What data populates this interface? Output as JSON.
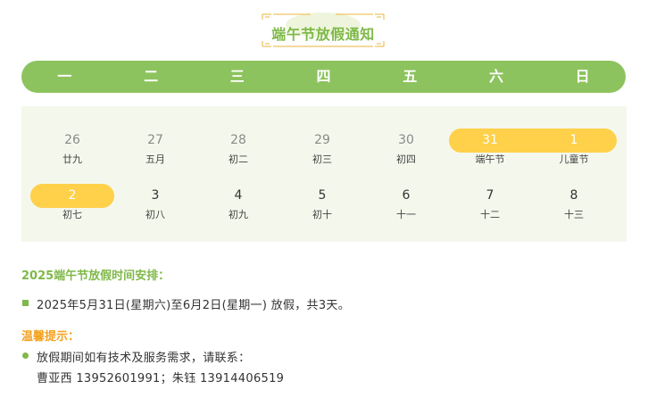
{
  "title": "端午节放假通知",
  "weekdays": [
    "一",
    "二",
    "三",
    "四",
    "五",
    "六",
    "日"
  ],
  "calendar": {
    "row1": [
      {
        "day": "26",
        "lunar": "廿九"
      },
      {
        "day": "27",
        "lunar": "五月"
      },
      {
        "day": "28",
        "lunar": "初二"
      },
      {
        "day": "29",
        "lunar": "初三"
      },
      {
        "day": "30",
        "lunar": "初四"
      },
      {
        "day": "31",
        "lunar": "端午节"
      },
      {
        "day": "1",
        "lunar": "儿童节"
      }
    ],
    "row2": [
      {
        "day": "2",
        "lunar": "初七"
      },
      {
        "day": "3",
        "lunar": "初八"
      },
      {
        "day": "4",
        "lunar": "初九"
      },
      {
        "day": "5",
        "lunar": "初十"
      },
      {
        "day": "6",
        "lunar": "十一"
      },
      {
        "day": "7",
        "lunar": "十二"
      },
      {
        "day": "8",
        "lunar": "十三"
      }
    ]
  },
  "schedule": {
    "heading": "2025端午节放假时间安排：",
    "text": "2025年5月31日(星期六)至6月2日(星期一) 放假，共3天。"
  },
  "tips": {
    "heading": "温馨提示：",
    "line1": "放假期间如有技术及服务需求，请联系：",
    "line2": "曹亚西 13952601991；朱钰 13914406519"
  },
  "colors": {
    "green": "#8dc35e",
    "title_green": "#7fb949",
    "highlight_yellow": "#ffd04a",
    "tip_orange": "#f2a21f",
    "calendar_bg": "#f4f8ec"
  }
}
